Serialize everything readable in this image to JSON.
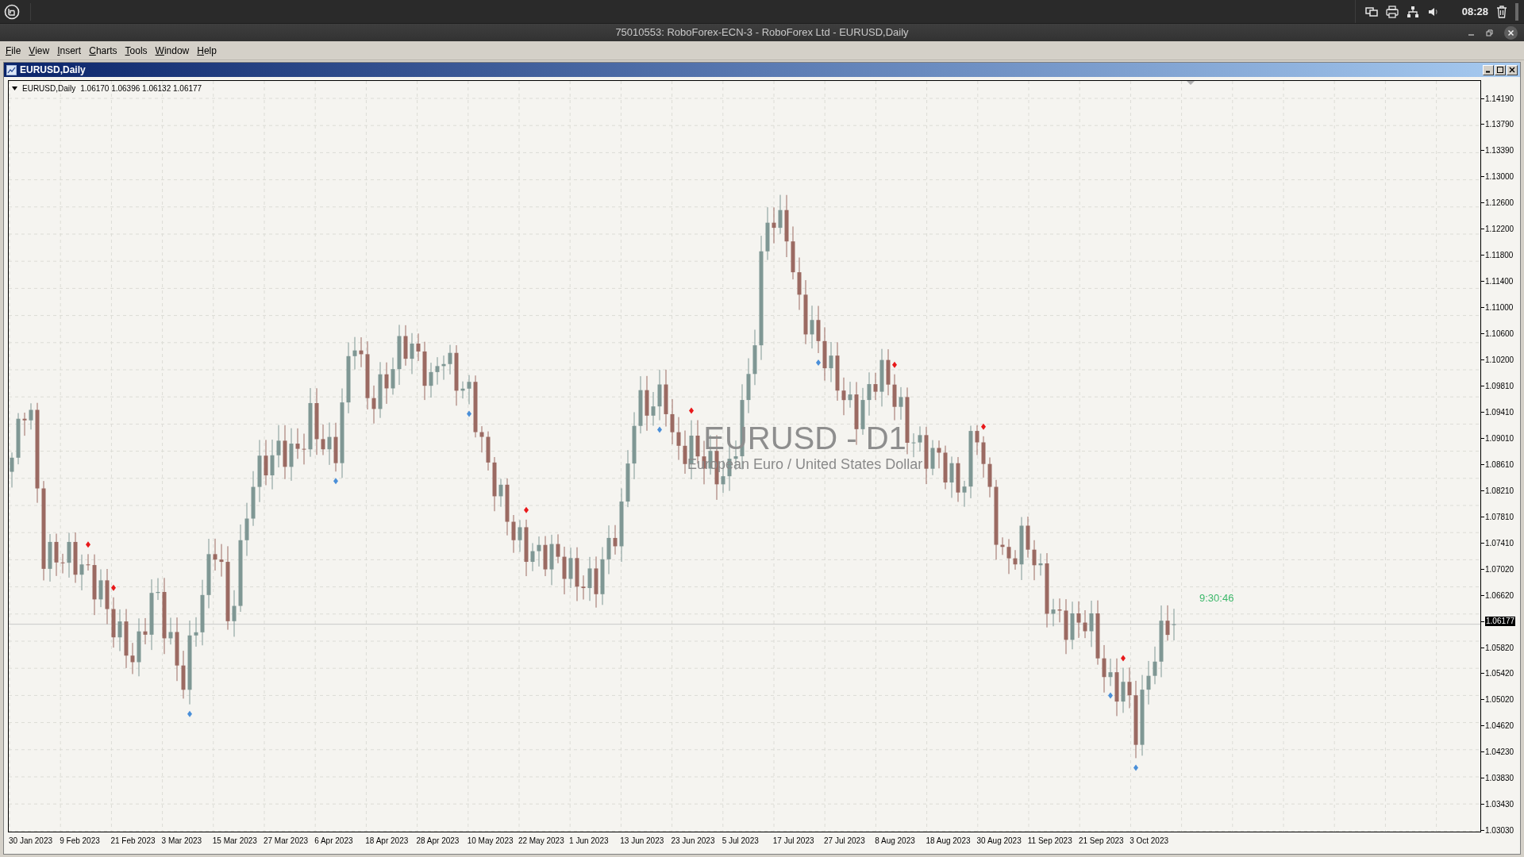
{
  "taskbar": {
    "clock": "08:28"
  },
  "window": {
    "title": "75010553: RoboForex-ECN-3 - RoboForex Ltd - EURUSD,Daily"
  },
  "menu": [
    "File",
    "View",
    "Insert",
    "Charts",
    "Tools",
    "Window",
    "Help"
  ],
  "chart_window": {
    "title": "EURUSD,Daily",
    "legend": {
      "symbol": "EURUSD,Daily",
      "ohlc": "1.06170 1.06396 1.06132 1.06177"
    },
    "watermark": {
      "symbol": "EURUSD - D1",
      "description": "European Euro / United States Dollar"
    },
    "countdown": "9:30:46",
    "price_axis": [
      {
        "kind": "tick",
        "label": "1.14190"
      },
      {
        "kind": "tick",
        "label": "1.13790"
      },
      {
        "kind": "tick",
        "label": "1.13390"
      },
      {
        "kind": "tick",
        "label": "1.13000"
      },
      {
        "kind": "tick",
        "label": "1.12600"
      },
      {
        "kind": "tick",
        "label": "1.12200"
      },
      {
        "kind": "tick",
        "label": "1.11800"
      },
      {
        "kind": "tick",
        "label": "1.11400"
      },
      {
        "kind": "tick",
        "label": "1.11000"
      },
      {
        "kind": "tick",
        "label": "1.10600"
      },
      {
        "kind": "tick",
        "label": "1.10200"
      },
      {
        "kind": "tick",
        "label": "1.09810"
      },
      {
        "kind": "tick",
        "label": "1.09410"
      },
      {
        "kind": "tick",
        "label": "1.09010"
      },
      {
        "kind": "tick",
        "label": "1.08610"
      },
      {
        "kind": "tick",
        "label": "1.08210"
      },
      {
        "kind": "tick",
        "label": "1.07810"
      },
      {
        "kind": "tick",
        "label": "1.07410"
      },
      {
        "kind": "tick",
        "label": "1.07020"
      },
      {
        "kind": "tick",
        "label": "1.06620"
      },
      {
        "kind": "current",
        "label": "1.06177"
      },
      {
        "kind": "tick",
        "label": "1.05820"
      },
      {
        "kind": "tick",
        "label": "1.05420"
      },
      {
        "kind": "tick",
        "label": "1.05020"
      },
      {
        "kind": "tick",
        "label": "1.04620"
      },
      {
        "kind": "tick",
        "label": "1.04230"
      },
      {
        "kind": "tick",
        "label": "1.03830"
      },
      {
        "kind": "tick",
        "label": "1.03430"
      },
      {
        "kind": "tick",
        "label": "1.03030"
      }
    ],
    "time_axis": [
      "30 Jan 2023",
      "9 Feb 2023",
      "21 Feb 2023",
      "3 Mar 2023",
      "15 Mar 2023",
      "27 Mar 2023",
      "6 Apr 2023",
      "18 Apr 2023",
      "28 Apr 2023",
      "10 May 2023",
      "22 May 2023",
      "1 Jun 2023",
      "13 Jun 2023",
      "23 Jun 2023",
      "5 Jul 2023",
      "17 Jul 2023",
      "27 Jul 2023",
      "8 Aug 2023",
      "18 Aug 2023",
      "30 Aug 2023",
      "11 Sep 2023",
      "21 Sep 2023",
      "3 Oct 2023"
    ]
  }
}
